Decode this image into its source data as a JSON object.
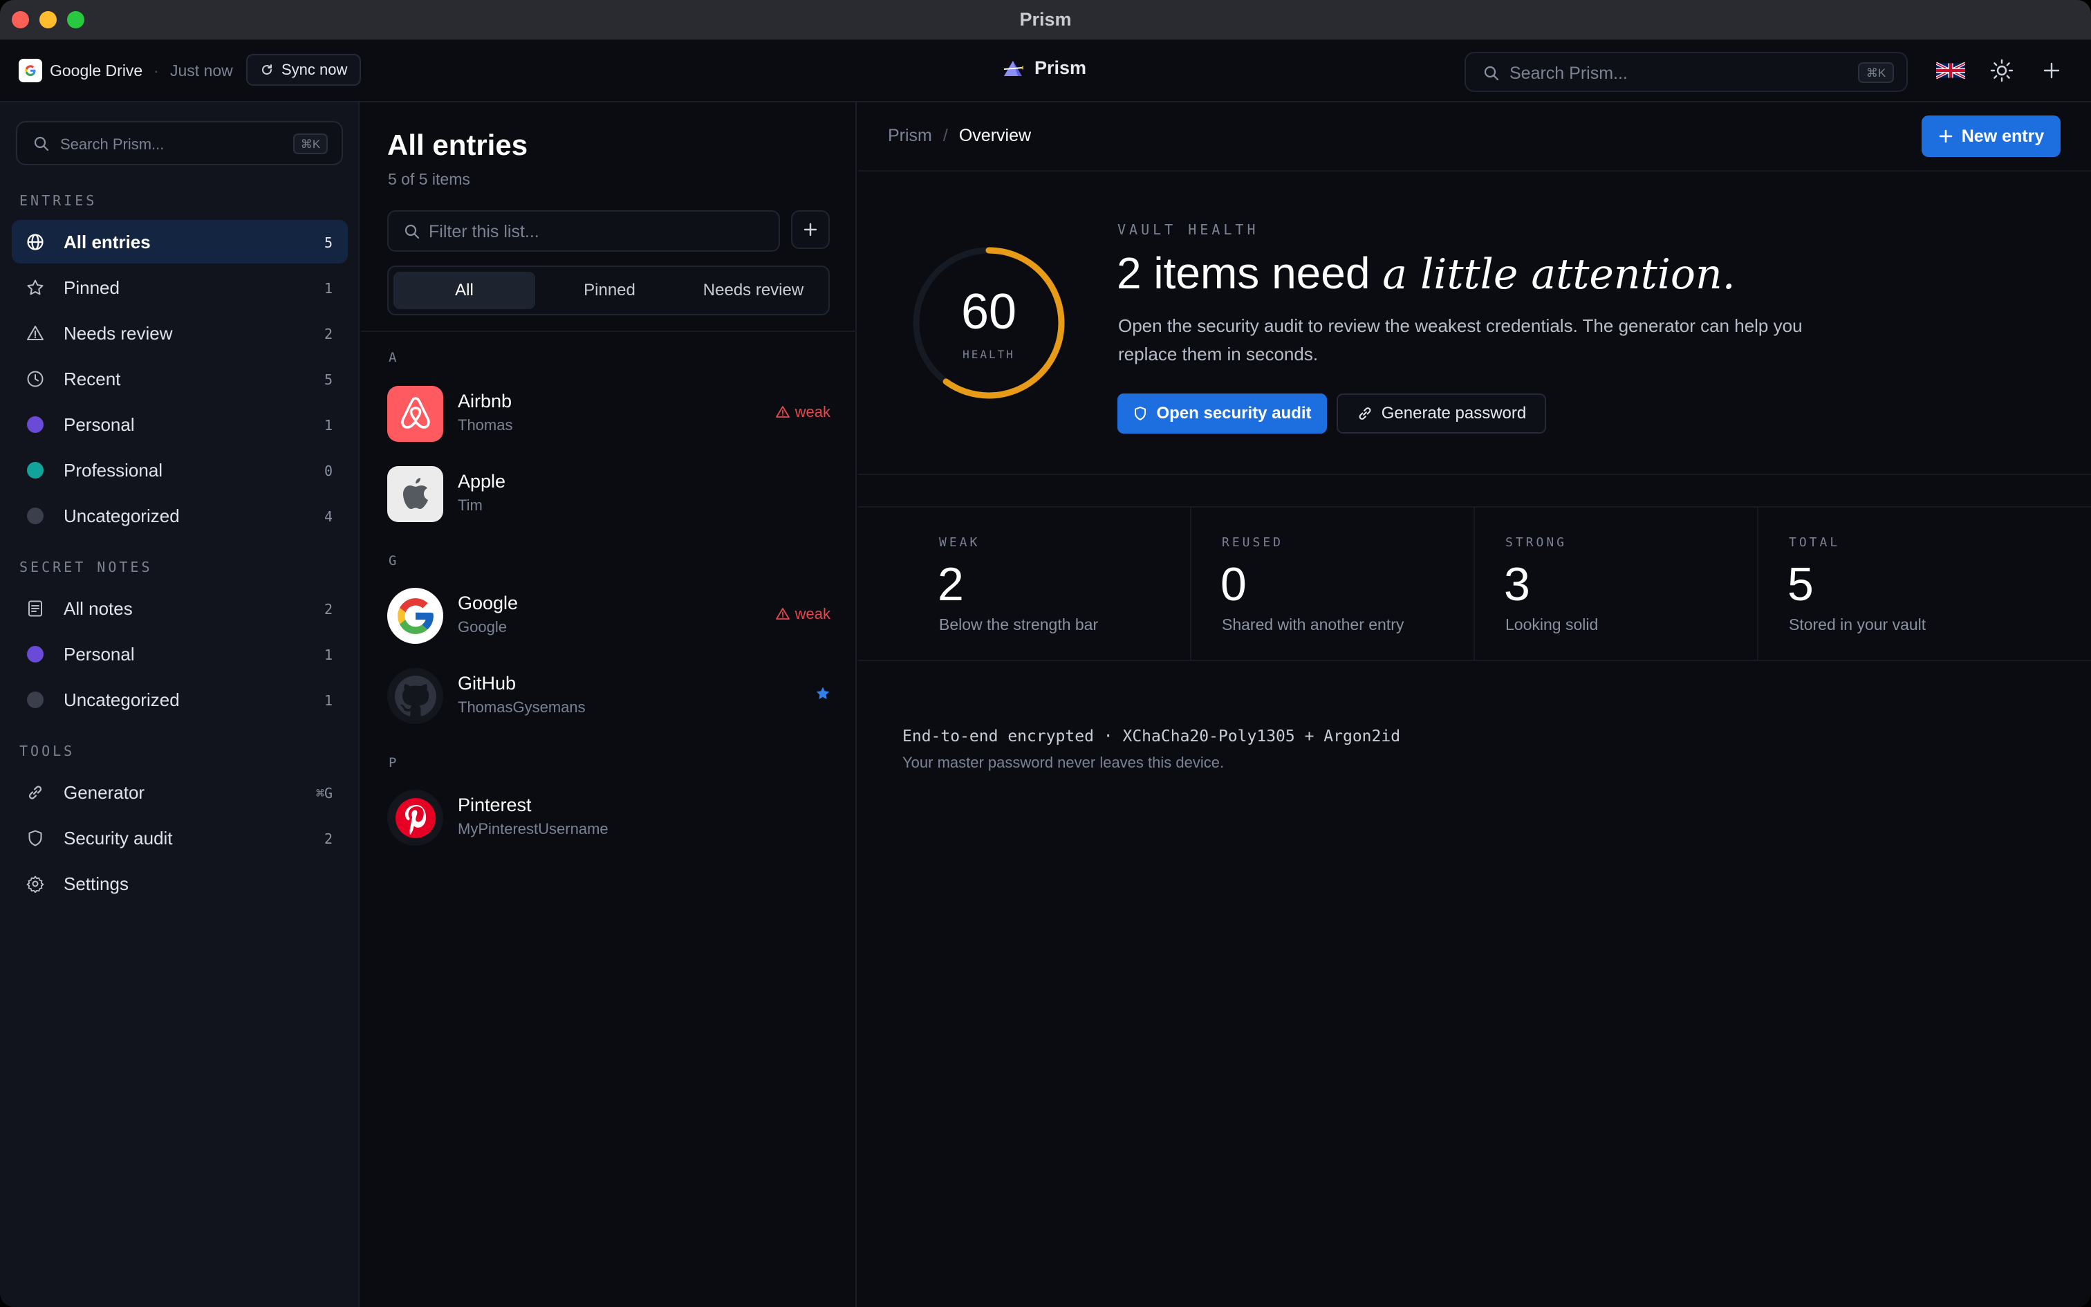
{
  "window": {
    "title": "Prism"
  },
  "header": {
    "provider": "Google Drive",
    "separator": "·",
    "last_sync": "Just now",
    "sync_label": "Sync now",
    "brand": "Prism",
    "search_placeholder": "Search Prism...",
    "search_shortcut": "⌘K",
    "icons": [
      "google-logo-icon",
      "refresh-icon",
      "prism-logo-icon",
      "search-icon",
      "uk-flag-icon",
      "sun-icon",
      "plus-icon"
    ]
  },
  "sidebar": {
    "search_placeholder": "Search Prism...",
    "search_shortcut": "⌘K",
    "entries_header": "ENTRIES",
    "entries": [
      {
        "label": "All entries",
        "count": "5",
        "icon": "globe-icon",
        "active": true
      },
      {
        "label": "Pinned",
        "count": "1",
        "icon": "star-icon"
      },
      {
        "label": "Needs review",
        "count": "2",
        "icon": "warning-icon"
      },
      {
        "label": "Recent",
        "count": "5",
        "icon": "clock-icon"
      },
      {
        "label": "Personal",
        "count": "1",
        "icon": "purple-dot",
        "color": "#6c4ad8"
      },
      {
        "label": "Professional",
        "count": "0",
        "icon": "teal-dot",
        "color": "#12a39a"
      },
      {
        "label": "Uncategorized",
        "count": "4",
        "icon": "gray-dot",
        "color": "#3a3f4b"
      }
    ],
    "notes_header": "SECRET NOTES",
    "notes": [
      {
        "label": "All notes",
        "count": "2",
        "icon": "note-icon"
      },
      {
        "label": "Personal",
        "count": "1",
        "icon": "purple-dot",
        "color": "#6c4ad8"
      },
      {
        "label": "Uncategorized",
        "count": "1",
        "icon": "gray-dot",
        "color": "#3a3f4b"
      }
    ],
    "tools_header": "TOOLS",
    "tools": [
      {
        "label": "Generator",
        "count": "⌘G",
        "icon": "link-icon"
      },
      {
        "label": "Security audit",
        "count": "2",
        "icon": "shield-icon"
      },
      {
        "label": "Settings",
        "count": "",
        "icon": "gear-icon"
      }
    ]
  },
  "list": {
    "title": "All entries",
    "subtitle": "5 of 5 items",
    "filter_placeholder": "Filter this list...",
    "segments": [
      "All",
      "Pinned",
      "Needs review"
    ],
    "groups": [
      {
        "letter": "A",
        "items": [
          {
            "name": "Airbnb",
            "user": "Thomas",
            "badge": "weak"
          },
          {
            "name": "Apple",
            "user": "Tim"
          }
        ]
      },
      {
        "letter": "G",
        "items": [
          {
            "name": "Google",
            "user": "Google",
            "badge": "weak"
          },
          {
            "name": "GitHub",
            "user": "ThomasGysemans",
            "pinned": true
          }
        ]
      },
      {
        "letter": "P",
        "items": [
          {
            "name": "Pinterest",
            "user": "MyPinterestUsername"
          }
        ]
      }
    ]
  },
  "main": {
    "breadcrumb": [
      "Prism",
      "Overview"
    ],
    "breadcrumb_sep": "/",
    "new_entry": "New entry",
    "vault_health": {
      "eyebrow": "VAULT HEALTH",
      "score": "60",
      "score_fraction": 0.6,
      "score_label": "HEALTH",
      "headline": "2 items need",
      "headline_emph": "a little attention.",
      "description": "Open the security audit to review the weakest credentials. The generator can help you replace them in seconds.",
      "audit_button": "Open security audit",
      "generate_button": "Generate password"
    },
    "stats": [
      {
        "key": "WEAK",
        "value": "2",
        "desc": "Below the strength bar"
      },
      {
        "key": "REUSED",
        "value": "0",
        "desc": "Shared with another entry"
      },
      {
        "key": "STRONG",
        "value": "3",
        "desc": "Looking solid"
      },
      {
        "key": "TOTAL",
        "value": "5",
        "desc": "Stored in your vault"
      }
    ],
    "encryption": "End-to-end encrypted · XChaCha20-Poly1305 + Argon2id",
    "encryption_note": "Your master password never leaves this device."
  },
  "colors": {
    "accent": "#1d6fe0",
    "warning": "#e5484d",
    "gauge": "#e89b17",
    "active_nav": "#142542"
  }
}
